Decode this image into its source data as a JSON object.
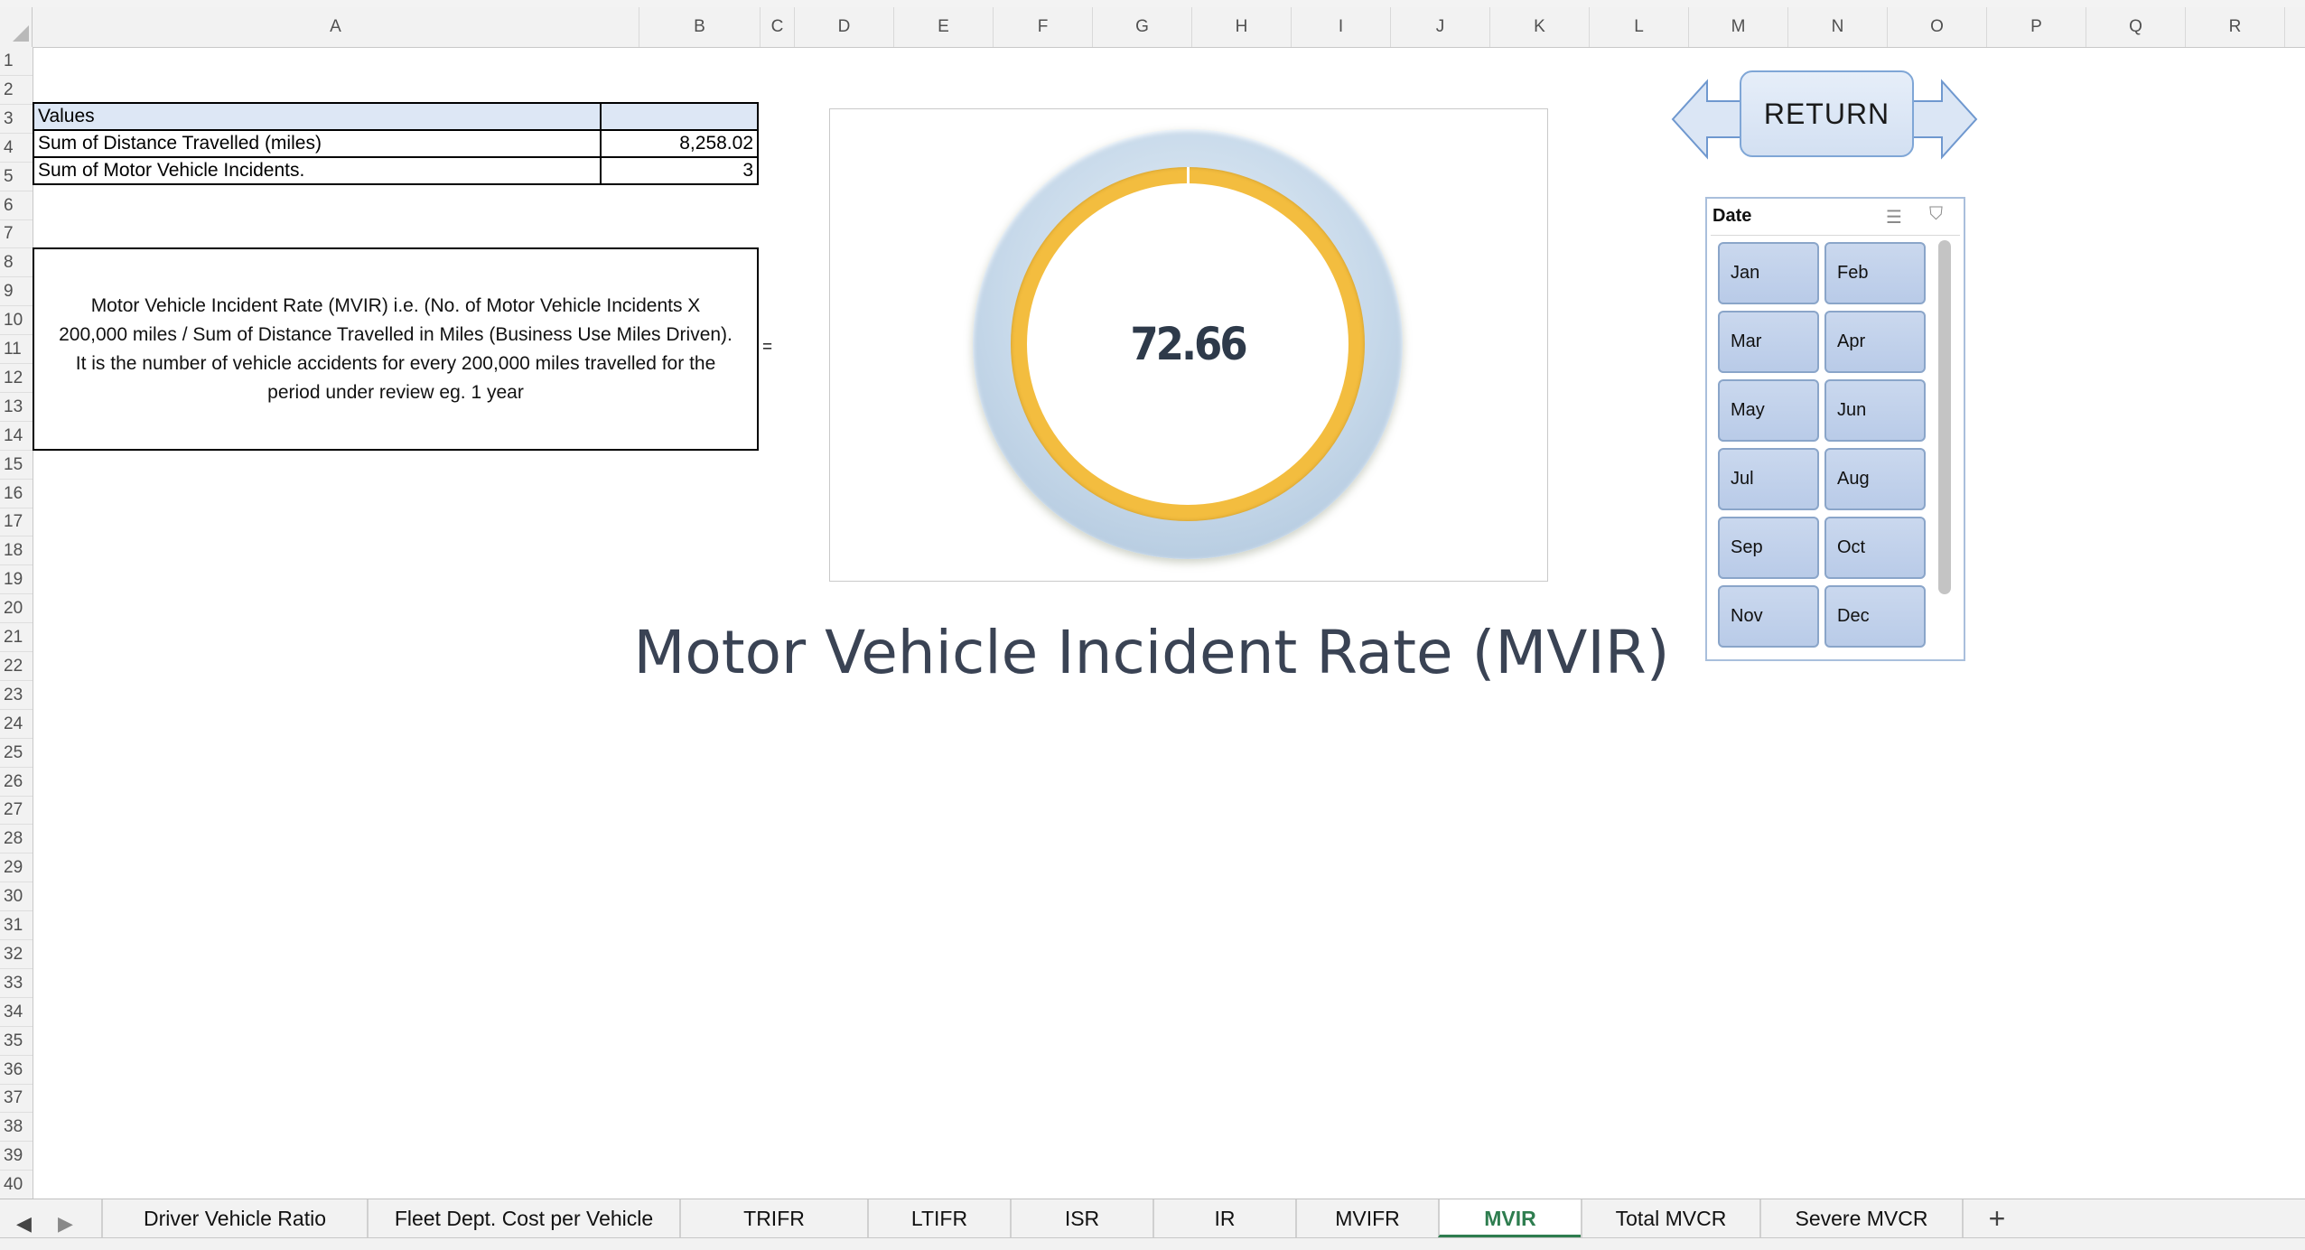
{
  "columns": [
    "A",
    "B",
    "C",
    "D",
    "E",
    "F",
    "G",
    "H",
    "I",
    "J",
    "K",
    "L",
    "M",
    "N",
    "O",
    "P",
    "Q",
    "R"
  ],
  "rows": [
    "1",
    "2",
    "3",
    "4",
    "5",
    "6",
    "7",
    "8",
    "9",
    "10",
    "11",
    "12",
    "13",
    "14",
    "15",
    "16",
    "17",
    "18",
    "19",
    "20",
    "21",
    "22",
    "23",
    "24",
    "25",
    "26",
    "27",
    "28",
    "29",
    "30",
    "31",
    "32",
    "33",
    "34",
    "35",
    "36",
    "37",
    "38",
    "39",
    "40"
  ],
  "pivot": {
    "header": "Values",
    "row1_label": "Sum of Distance Travelled (miles)",
    "row1_value": "8,258.02",
    "row2_label": "Sum of Motor Vehicle Incidents.",
    "row2_value": "3"
  },
  "formula": {
    "line1": "Motor Vehicle Incident Rate (MVIR) i.e. (No. of Motor Vehicle Incidents X",
    "line2": "200,000 miles / Sum of Distance Travelled in Miles (Business Use Miles Driven).",
    "line3": "It is the number of vehicle accidents for every 200,000 miles travelled for the",
    "line4": "period under review eg. 1 year",
    "equals": "="
  },
  "gauge": {
    "value": "72.66",
    "ring_color": "#f3bd3f",
    "bezel_color": "#c7d9ea"
  },
  "title": "Motor Vehicle Incident Rate (MVIR)",
  "return_button": {
    "label": "RETURN"
  },
  "slicer": {
    "title": "Date",
    "multi_select_icon": "multi-select-icon",
    "clear_filter_icon": "clear-filter-icon",
    "items": [
      "Jan",
      "Feb",
      "Mar",
      "Apr",
      "May",
      "Jun",
      "Jul",
      "Aug",
      "Sep",
      "Oct",
      "Nov",
      "Dec"
    ]
  },
  "tabs": [
    {
      "label": "Driver Vehicle Ratio"
    },
    {
      "label": "Fleet Dept. Cost per Vehicle"
    },
    {
      "label": "TRIFR"
    },
    {
      "label": "LTIFR"
    },
    {
      "label": "ISR"
    },
    {
      "label": "IR"
    },
    {
      "label": "MVIFR"
    },
    {
      "label": "MVIR"
    },
    {
      "label": "Total MVCR"
    },
    {
      "label": "Severe MVCR"
    }
  ],
  "active_tab": "MVIR",
  "add_sheet": "+",
  "accent_color": "#2e7d4f"
}
